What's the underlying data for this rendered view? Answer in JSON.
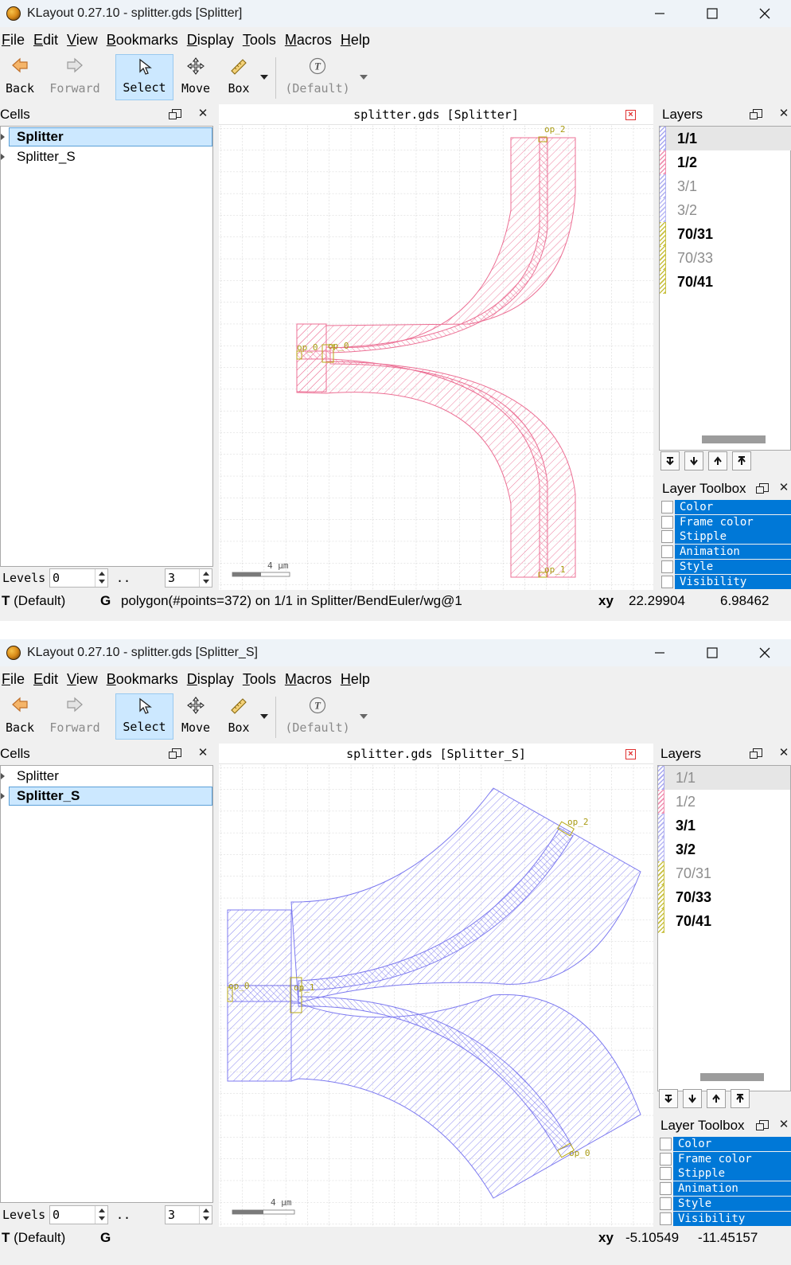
{
  "windows": [
    {
      "title": "KLayout 0.27.10 - splitter.gds [Splitter]",
      "menu": [
        "File",
        "Edit",
        "View",
        "Bookmarks",
        "Display",
        "Tools",
        "Macros",
        "Help"
      ],
      "toolbar": {
        "back": "Back",
        "forward": "Forward",
        "select": "Select",
        "move": "Move",
        "box": "Box",
        "default": "(Default)"
      },
      "cells_panel": {
        "title": "Cells",
        "items": [
          "Splitter",
          "Splitter_S"
        ],
        "selected": 0
      },
      "levels": {
        "label": "Levels",
        "from": "0",
        "sep": "..",
        "to": "3"
      },
      "canvas": {
        "title": "splitter.gds [Splitter]",
        "scale_label": "4 µm",
        "ports": [
          "op_2",
          "op_0",
          "op_0",
          "op_1"
        ],
        "color": "#ec6f94"
      },
      "layers_panel": {
        "title": "Layers",
        "layers": [
          {
            "name": "1/1",
            "visible": true
          },
          {
            "name": "1/2",
            "visible": true
          },
          {
            "name": "3/1",
            "visible": false
          },
          {
            "name": "3/2",
            "visible": false
          },
          {
            "name": "70/31",
            "visible": true
          },
          {
            "name": "70/33",
            "visible": false
          },
          {
            "name": "70/41",
            "visible": true
          }
        ]
      },
      "toolbox": {
        "title": "Layer Toolbox",
        "items": [
          "Color",
          "Frame color",
          "Stipple",
          "Animation",
          "Style",
          "Visibility"
        ]
      },
      "status": {
        "mode_prefix": "T",
        "mode": "(Default)",
        "g": "G",
        "message": "polygon(#points=372) on 1/1 in Splitter/BendEuler/wg@1",
        "xy_label": "xy",
        "x": "22.29904",
        "y": "6.98462"
      }
    },
    {
      "title": "KLayout 0.27.10 - splitter.gds [Splitter_S]",
      "menu": [
        "File",
        "Edit",
        "View",
        "Bookmarks",
        "Display",
        "Tools",
        "Macros",
        "Help"
      ],
      "toolbar": {
        "back": "Back",
        "forward": "Forward",
        "select": "Select",
        "move": "Move",
        "box": "Box",
        "default": "(Default)"
      },
      "cells_panel": {
        "title": "Cells",
        "items": [
          "Splitter",
          "Splitter_S"
        ],
        "selected": 1
      },
      "levels": {
        "label": "Levels",
        "from": "0",
        "sep": "..",
        "to": "3"
      },
      "canvas": {
        "title": "splitter.gds [Splitter_S]",
        "scale_label": "4 µm",
        "ports": [
          "op_2",
          "op_0",
          "op_1",
          "op_0"
        ],
        "color": "#7c79f0"
      },
      "layers_panel": {
        "title": "Layers",
        "layers": [
          {
            "name": "1/1",
            "visible": false
          },
          {
            "name": "1/2",
            "visible": false
          },
          {
            "name": "3/1",
            "visible": true
          },
          {
            "name": "3/2",
            "visible": true
          },
          {
            "name": "70/31",
            "visible": false
          },
          {
            "name": "70/33",
            "visible": true
          },
          {
            "name": "70/41",
            "visible": true
          }
        ]
      },
      "toolbox": {
        "title": "Layer Toolbox",
        "items": [
          "Color",
          "Frame color",
          "Stipple",
          "Animation",
          "Style",
          "Visibility"
        ]
      },
      "status": {
        "mode_prefix": "T",
        "mode": "(Default)",
        "g": "G",
        "message": "",
        "xy_label": "xy",
        "x": "-5.10549",
        "y": "-11.45157"
      }
    }
  ],
  "layer_colors": {
    "1/1": "#a8a8f0",
    "1/2": "#f08fb0",
    "3/1": "#b0b0f0",
    "3/2": "#b8b8f4",
    "70/31": "#c8c040",
    "70/33": "#c8c040",
    "70/41": "#c8c040"
  }
}
